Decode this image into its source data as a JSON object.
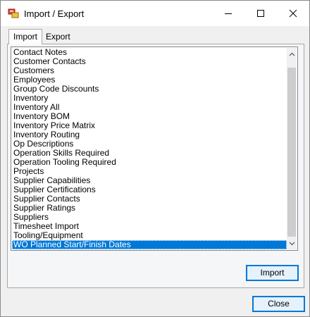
{
  "window": {
    "title": "Import / Export",
    "icon": "import-export-app-icon"
  },
  "tabs": [
    {
      "label": "Import",
      "selected": true
    },
    {
      "label": "Export",
      "selected": false
    }
  ],
  "import_list": {
    "items": [
      "Contact Notes",
      "Customer Contacts",
      "Customers",
      "Employees",
      "Group Code Discounts",
      "Inventory",
      "Inventory All",
      "Inventory BOM",
      "Inventory Price Matrix",
      "Inventory Routing",
      "Op Descriptions",
      "Operation Skills Required",
      "Operation Tooling Required",
      "Projects",
      "Supplier Capabilities",
      "Supplier Certifications",
      "Supplier Contacts",
      "Supplier Ratings",
      "Suppliers",
      "Timesheet Import",
      "Tooling/Equipment",
      "WO Planned Start/Finish Dates"
    ],
    "selected_item": "WO Planned Start/Finish Dates"
  },
  "buttons": {
    "import_label": "Import",
    "close_label": "Close"
  },
  "colors": {
    "selection": "#0078d7",
    "default_button_border": "#0078d7"
  }
}
